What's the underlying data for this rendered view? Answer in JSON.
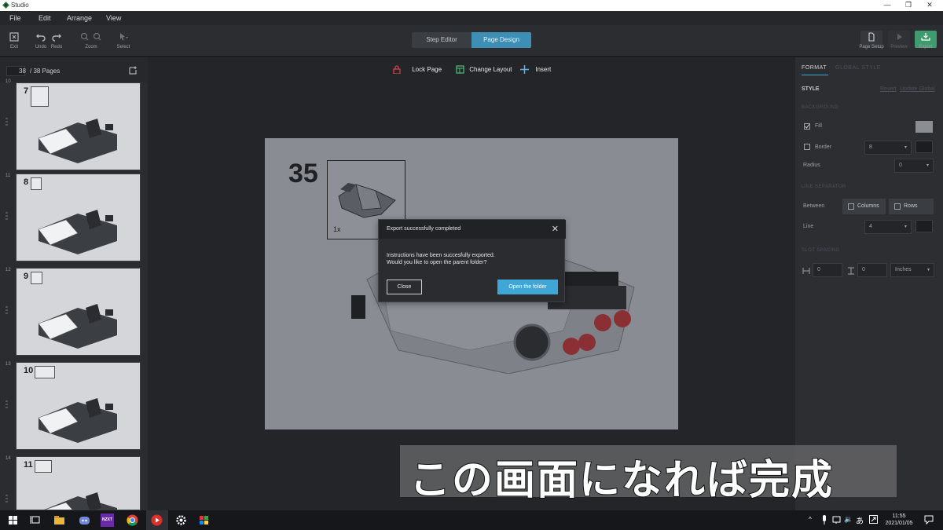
{
  "window": {
    "title": "Studio",
    "minimize": "—",
    "maximize": "❐",
    "close": "✕"
  },
  "menu": [
    "File",
    "Edit",
    "Arrange",
    "View"
  ],
  "toolbar": {
    "exit": "Exit",
    "undo": "Undo",
    "redo": "Redo",
    "zoom": "Zoom",
    "select": "Select",
    "step_editor": "Step Editor",
    "page_design": "Page Design",
    "page_setup": "Page Setup",
    "preview": "Preview",
    "export": "Export"
  },
  "left_panel": {
    "page_current": "38",
    "page_total": "/ 38 Pages",
    "thumbs": [
      {
        "index": "10",
        "step": "7"
      },
      {
        "index": "11",
        "step": "8"
      },
      {
        "index": "12",
        "step": "9"
      },
      {
        "index": "13",
        "step": "10"
      },
      {
        "index": "14",
        "step": "11"
      }
    ]
  },
  "canvas_toolbar": {
    "lock_page": "Lock Page",
    "change_layout": "Change Layout",
    "insert": "Insert"
  },
  "page": {
    "step_number": "35",
    "callout_qty": "1x"
  },
  "dialog": {
    "title": "Export successfully completed",
    "line1": "Instructions have been succesfully exported.",
    "line2": "Would you like to open the parent folder?",
    "close_button": "Close",
    "open_button": "Open the folder"
  },
  "right_panel": {
    "tab_format": "FORMAT",
    "tab_global": "GLOBAL STYLE",
    "style": "STYLE",
    "revert": "Revert",
    "update_global": "Update Global",
    "background": "BACKGROUND",
    "fill": "Fill",
    "border": "Border",
    "border_value": "8",
    "radius": "Radius",
    "radius_value": "0",
    "line_separator": "LINE SEPARATOR",
    "between": "Between",
    "columns": "Columns",
    "rows": "Rows",
    "line": "Line",
    "line_value": "4",
    "slot_spacing": "SLOT SPACING",
    "spacing_h": "0",
    "spacing_v": "0",
    "units": "Inches",
    "fill_color": "#8a8d91",
    "border_color": "#1c1d20",
    "line_color": "#1c1d20"
  },
  "subtitle": "この画面になれば完成",
  "taskbar": {
    "time": "11:55",
    "date": "2021/01/05",
    "ime": "あ",
    "apps": [
      "windows-start",
      "task-view",
      "file-explorer",
      "discord",
      "nzxt",
      "chrome",
      "youtube",
      "settings",
      "studio"
    ],
    "nzxt_label": "NZXT"
  },
  "colors": {
    "accent": "#3fa7d8",
    "segment_active": "#3d8fb6",
    "export_green": "#3f9a6e"
  }
}
